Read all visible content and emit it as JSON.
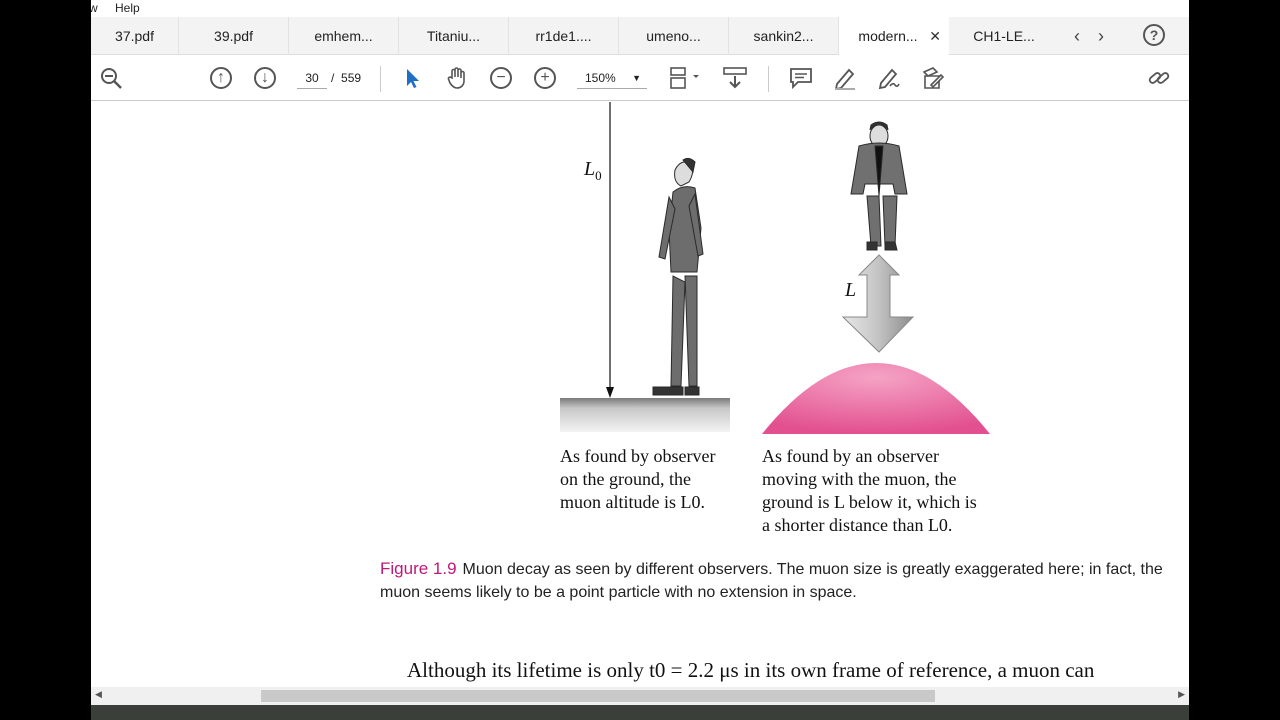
{
  "menubar": {
    "partial": "w",
    "help": "Help"
  },
  "tabs": [
    {
      "label": "37.pdf"
    },
    {
      "label": "39.pdf"
    },
    {
      "label": "emhem..."
    },
    {
      "label": "Titaniu..."
    },
    {
      "label": "rr1de1...."
    },
    {
      "label": "umeno..."
    },
    {
      "label": "sankin2..."
    },
    {
      "label": "modern...",
      "active": true
    },
    {
      "label": "CH1-LE..."
    }
  ],
  "toolbar": {
    "page_current": "30",
    "page_separator": "/",
    "page_total": "559",
    "zoom": "150%"
  },
  "figure": {
    "label_L0": "L",
    "label_L0_sub": "0",
    "label_L": "L",
    "left_caption": [
      "As found by observer",
      "on the ground, the",
      "muon altitude is L0."
    ],
    "right_caption": [
      "As found by an observer",
      "moving with the muon, the",
      "ground is L below it, which is",
      "a shorter distance than L0."
    ]
  },
  "caption": {
    "figure_number": "Figure 1.9",
    "text": "Muon decay as seen by different observers. The muon size is greatly exaggerated here; in fact, the muon seems likely to be a point particle with no extension in space."
  },
  "body_text": "Although its lifetime is only t0 = 2.2 μs in its own frame of reference, a muon can",
  "colors": {
    "accent": "#c0177a",
    "muon_pink": "#e8609b"
  }
}
